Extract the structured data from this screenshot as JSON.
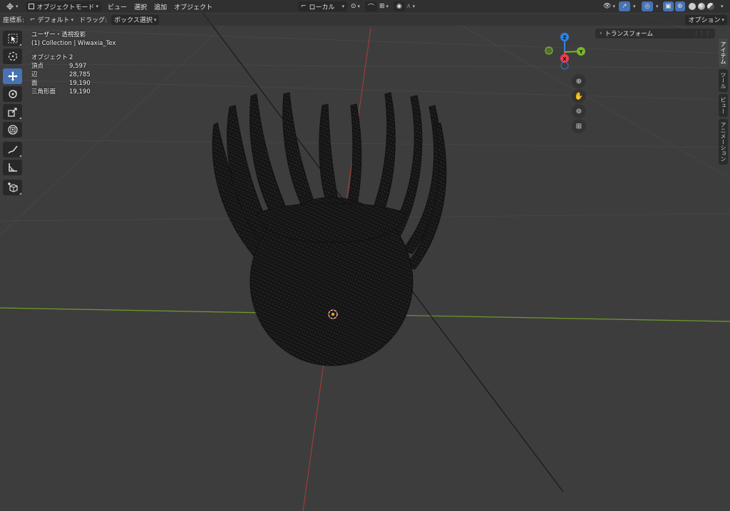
{
  "header": {
    "editor_type_icon": "3d-viewport-icon",
    "mode": "オブジェクトモード",
    "menus": [
      "ビュー",
      "選択",
      "追加",
      "オブジェクト"
    ],
    "transform_orientation": "ローカル"
  },
  "toolheader": {
    "orientation_label": "座標系:",
    "orientation_value": "デフォルト",
    "drag_label": "ドラッグ:",
    "drag_value": "ボックス選択",
    "options": "オプション"
  },
  "overlay": {
    "view_name": "ユーザー・透視投影",
    "collection": "(1) Collection | Wiwaxia_Tex",
    "stats": [
      {
        "label": "オブジェクト",
        "value": "2"
      },
      {
        "label": "頂点",
        "value": "9,597"
      },
      {
        "label": "辺",
        "value": "28,785"
      },
      {
        "label": "面",
        "value": "19,190"
      },
      {
        "label": "三角形面",
        "value": "19,190"
      }
    ]
  },
  "sidebar": {
    "tabs": [
      "アイテム",
      "ツール",
      "ビュー",
      "アニメーション"
    ],
    "panel_title": "トランスフォーム"
  },
  "gizmo": {
    "axes": [
      "Z",
      "Y",
      "X"
    ],
    "colors": {
      "x": "#f53a53",
      "y": "#7ab82a",
      "z": "#2f83e4"
    }
  },
  "toolbar": {
    "tools": [
      "select-box",
      "cursor",
      "move",
      "rotate",
      "scale",
      "transform",
      "annotate",
      "measure",
      "add-cube"
    ]
  },
  "colors": {
    "background": "#3d3d3d",
    "header": "#303030",
    "accent": "#4772b3"
  }
}
